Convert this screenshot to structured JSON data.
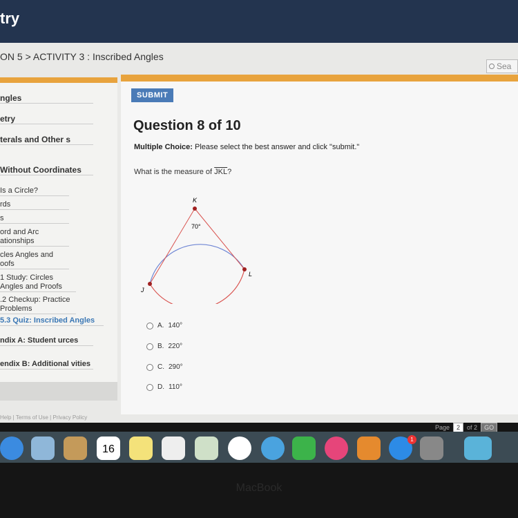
{
  "header": {
    "title": "try",
    "breadcrumb": "ON 5 > ACTIVITY 3 : Inscribed Angles",
    "search_placeholder": "Sea"
  },
  "sidebar": {
    "items": [
      "ngles",
      "etry",
      "terals and Other s",
      "Without Coordinates",
      "Is a Circle?",
      "rds",
      "s",
      "ord and Arc ationships",
      "cles Angles and oofs",
      "1  Study: Circles Angles and Proofs",
      ".2  Checkup: Practice Problems",
      "5.3  Quiz: Inscribed Angles",
      "ndix A: Student urces",
      "endix B: Additional vities"
    ]
  },
  "main": {
    "submit_label": "SUBMIT",
    "question_title": "Question 8 of 10",
    "mc_label": "Multiple Choice:",
    "mc_text": " Please select the best answer and click \"submit.\"",
    "prompt": "What is the measure of ",
    "arc_name": "JKL",
    "prompt_end": "?",
    "diagram": {
      "points": [
        "K",
        "L",
        "J"
      ],
      "arc_label": "70°"
    },
    "options": [
      {
        "letter": "A.",
        "value": "140°"
      },
      {
        "letter": "B.",
        "value": "220°"
      },
      {
        "letter": "C.",
        "value": "290°"
      },
      {
        "letter": "D.",
        "value": "110°"
      }
    ]
  },
  "footer": {
    "links": "Help  |  Terms of Use  |  Privacy Policy",
    "page_label": "Page",
    "page": "2",
    "of": "of 2",
    "go": "GO"
  },
  "dock": {
    "calendar_day": "16",
    "badge": "1"
  },
  "bezel": "MacBook",
  "colors": {
    "accent": "#e8a33d",
    "submit": "#4a7bb7",
    "header": "#23344f"
  }
}
